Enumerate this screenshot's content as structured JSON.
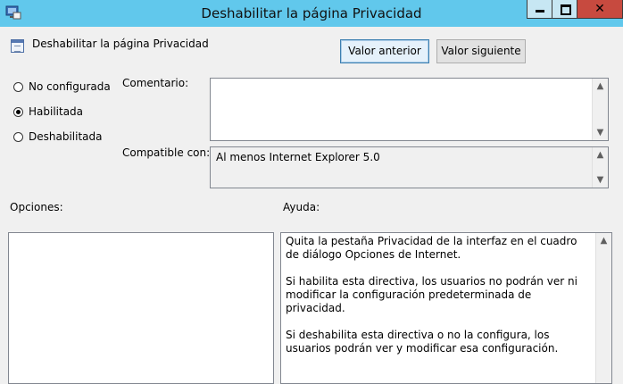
{
  "window": {
    "title": "Deshabilitar la página Privacidad",
    "controls": {
      "close": "✕"
    }
  },
  "policy": {
    "name": "Deshabilitar la página Privacidad"
  },
  "buttons": {
    "prev": "Valor anterior",
    "next": "Valor siguiente"
  },
  "state": {
    "options": [
      {
        "label": "No configurada",
        "checked": false
      },
      {
        "label": "Habilitada",
        "checked": true
      },
      {
        "label": "Deshabilitada",
        "checked": false
      }
    ]
  },
  "comment": {
    "label": "Comentario:",
    "value": ""
  },
  "compat": {
    "label": "Compatible con:",
    "value": "Al menos Internet Explorer 5.0"
  },
  "sections": {
    "options_label": "Opciones:",
    "help_label": "Ayuda:"
  },
  "help": {
    "paragraphs": [
      "Quita la pestaña Privacidad de la interfaz en el cuadro de diálogo Opciones de Internet.",
      "Si habilita esta directiva, los usuarios no podrán ver ni modificar la configuración predeterminada de privacidad.",
      "Si deshabilita esta directiva o no la configura, los usuarios podrán ver y modificar esa configuración."
    ]
  },
  "icons": {
    "app": "group-policy-icon",
    "policy": "policy-setting-icon",
    "scroll_up": "▲",
    "scroll_down": "▼"
  }
}
